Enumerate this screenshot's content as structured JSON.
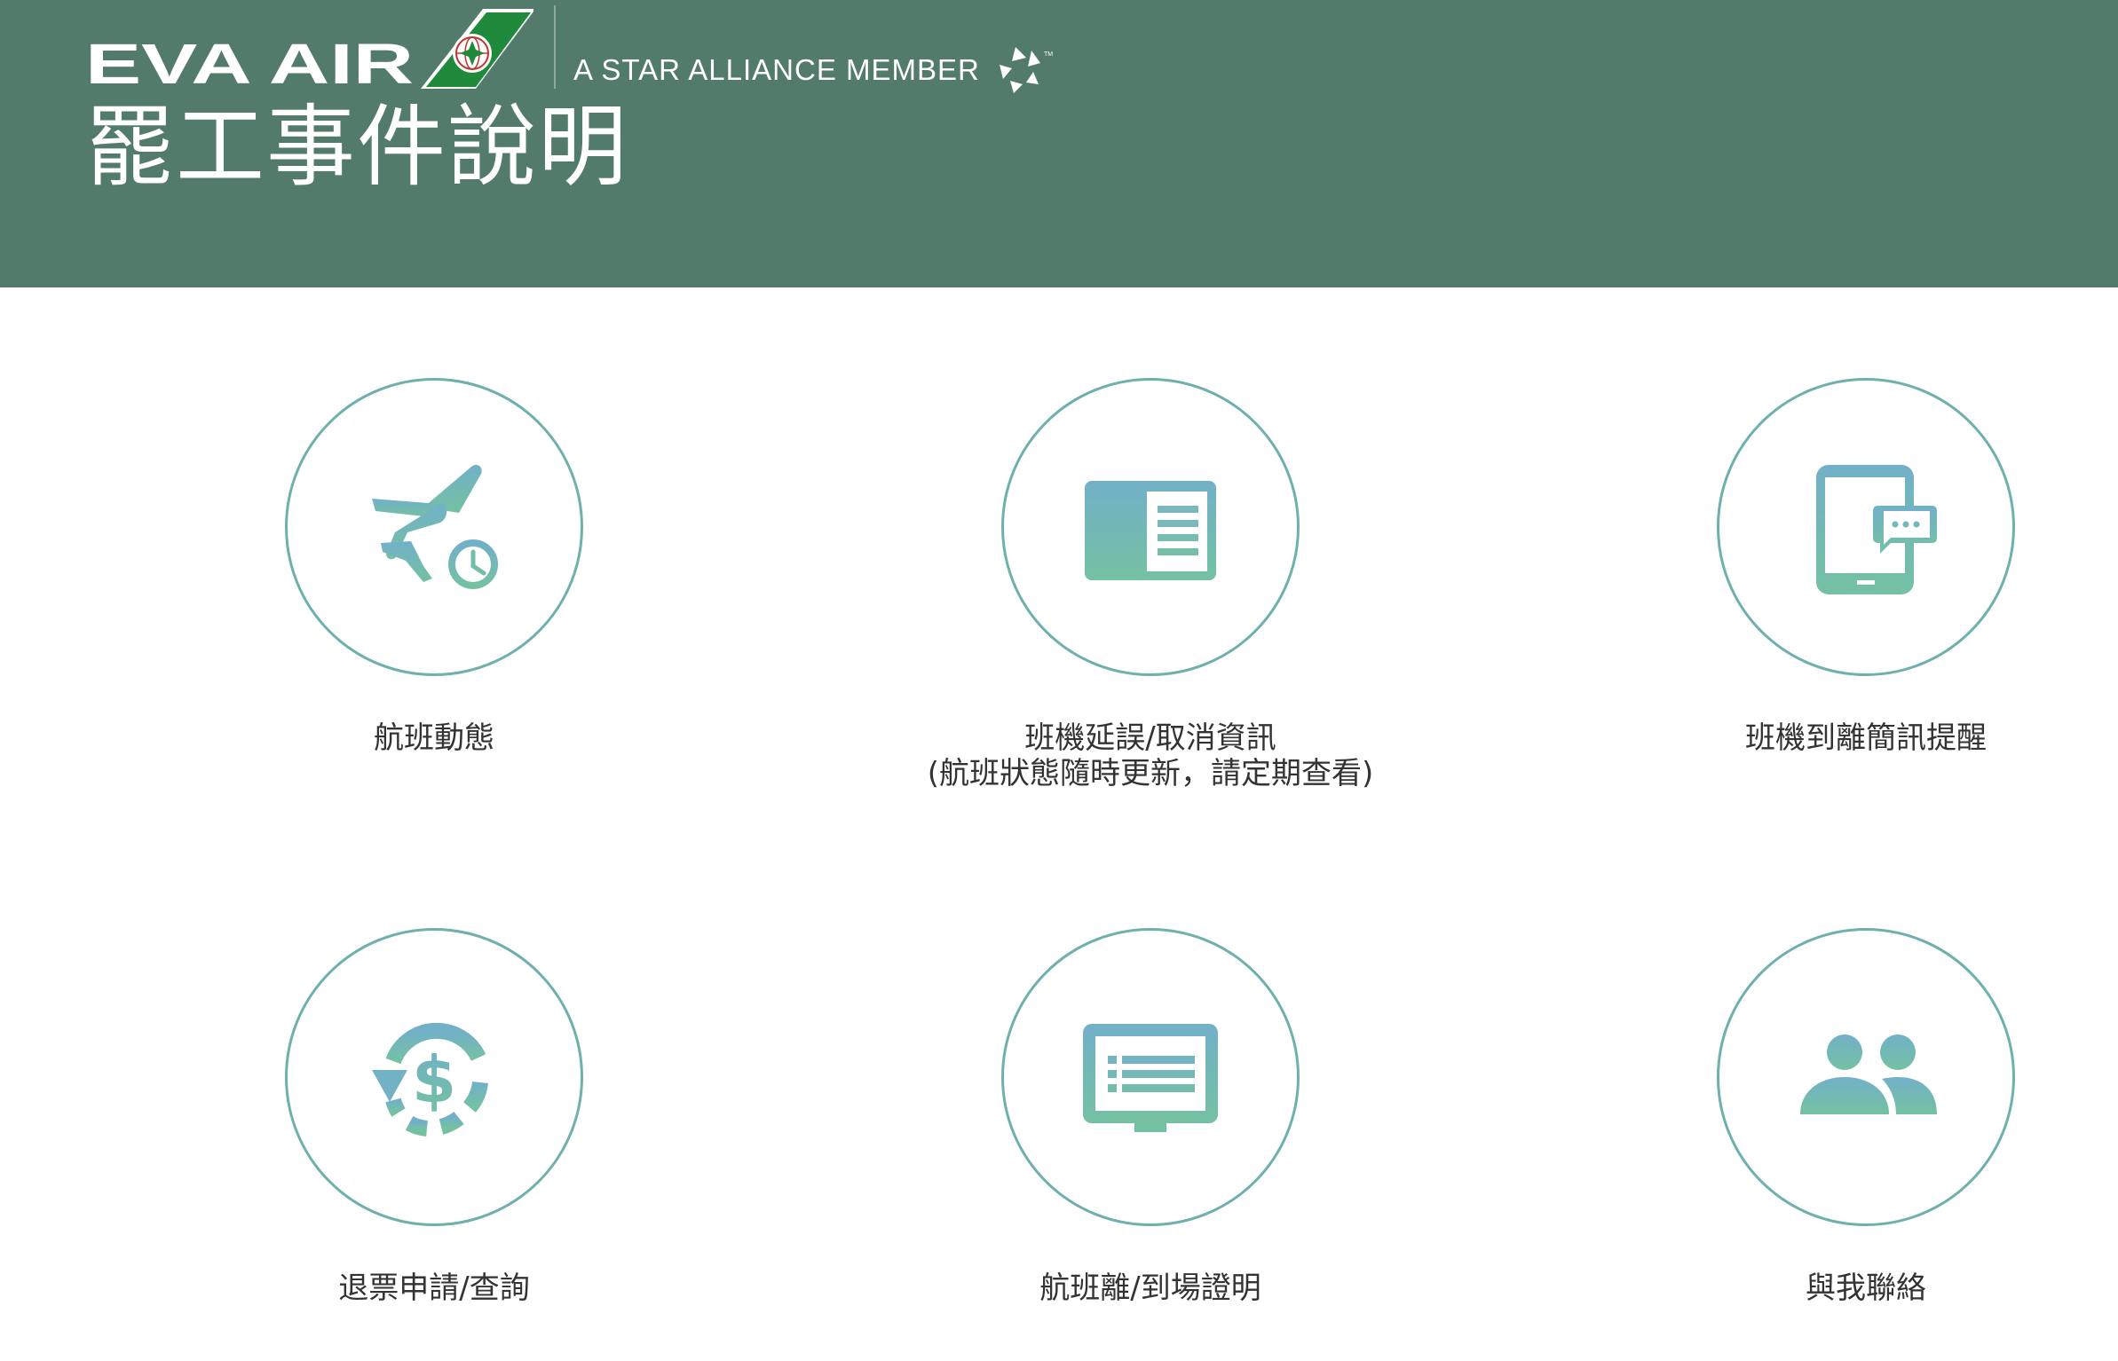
{
  "header": {
    "brand": "EVA AIR",
    "alliance_text": "A STAR ALLIANCE MEMBER",
    "page_title": "罷工事件說明",
    "background_color": "#527b6b"
  },
  "tiles": [
    {
      "label_line1": "航班動態",
      "label_line2": "",
      "icon": "plane-clock-icon"
    },
    {
      "label_line1": "班機延誤/取消資訊",
      "label_line2": "(航班狀態隨時更新，請定期查看)",
      "icon": "info-card-icon"
    },
    {
      "label_line1": "班機到離簡訊提醒",
      "label_line2": "",
      "icon": "phone-message-icon"
    },
    {
      "label_line1": "退票申請/查詢",
      "label_line2": "",
      "icon": "refund-dollar-icon"
    },
    {
      "label_line1": "航班離/到場證明",
      "label_line2": "",
      "icon": "monitor-list-icon"
    },
    {
      "label_line1": "與我聯絡",
      "label_line2": "",
      "icon": "contact-people-icon"
    }
  ],
  "colors": {
    "icon_gradient_top": "#72b0c8",
    "icon_gradient_bottom": "#74c1a2",
    "circle_border": "#6fb0ad",
    "label_text": "#333333"
  }
}
